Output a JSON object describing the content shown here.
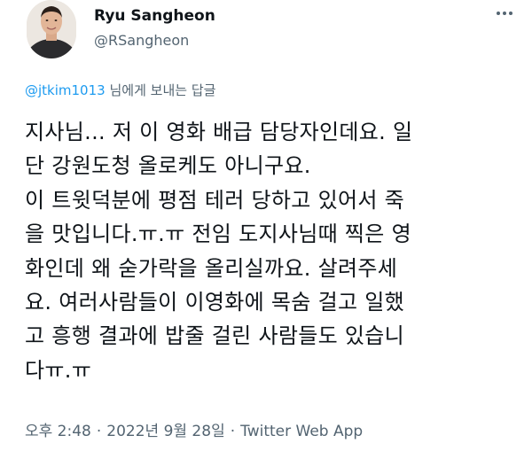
{
  "author": {
    "display_name": "Ryu Sangheon",
    "handle": "@RSangheon"
  },
  "reply": {
    "mention": "@jtkim1013",
    "suffix": "님에게 보내는 답글"
  },
  "tweet": {
    "lines": [
      "지사님... 저 이 영화 배급 담당자인데요. 일",
      "단 강원도청 올로케도 아니구요.",
      "이 트윗덕분에 평점 테러 당하고 있어서 죽",
      "을 맛입니다.ㅠ.ㅠ 전임 도지사님때 찍은 영",
      "화인데 왜 숟가락을 올리실까요. 살려주세",
      "요. 여러사람들이 이영화에 목숨 걸고 일했",
      "고 흥행 결과에 밥줄 걸린 사람들도 있습니",
      "다ㅠ.ㅠ"
    ]
  },
  "meta": {
    "time": "오후 2:48",
    "date": "2022년 9월 28일",
    "separator": "·",
    "source": "Twitter Web App"
  },
  "icons": {
    "more": "more-horizontal-icon"
  }
}
